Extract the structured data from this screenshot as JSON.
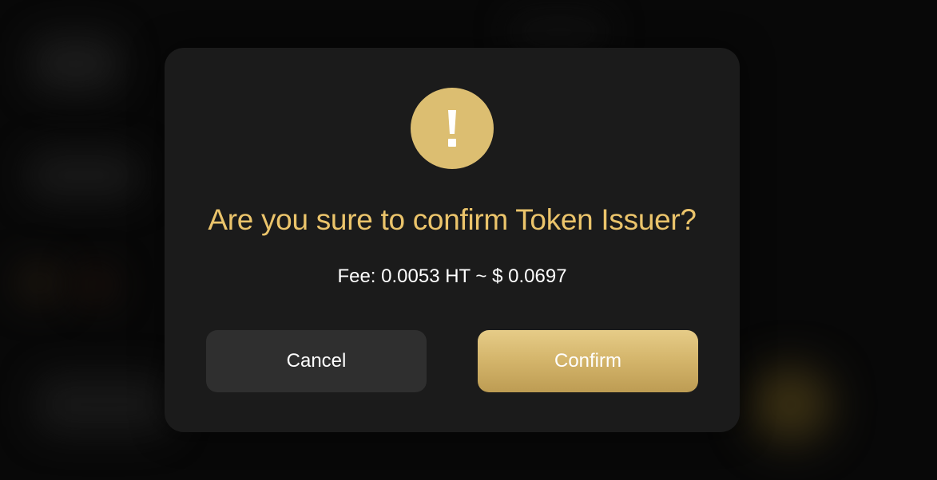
{
  "dialog": {
    "icon": "exclamation-warning-icon",
    "title": "Are you sure to confirm Token Issuer?",
    "fee_text": "Fee: 0.0053 HT ~ $ 0.0697",
    "cancel_label": "Cancel",
    "confirm_label": "Confirm"
  },
  "colors": {
    "accent_gold": "#ebc46b",
    "icon_bg": "#dcbe71",
    "dialog_bg": "#1b1b1b",
    "cancel_bg": "#2f2f2f"
  }
}
